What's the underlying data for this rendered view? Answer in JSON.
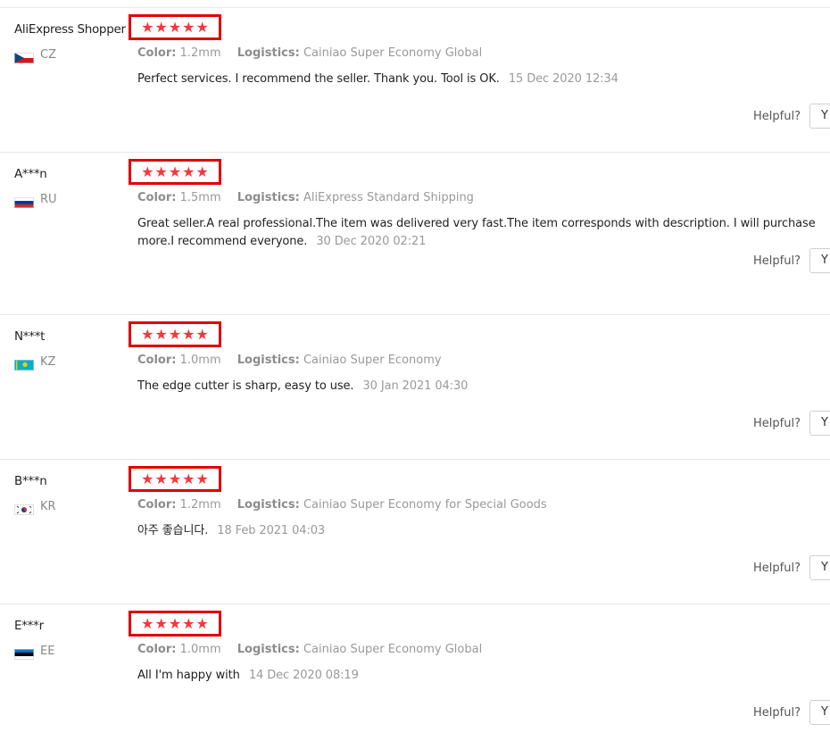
{
  "reviews": [
    {
      "user": "AliExpress Shopper",
      "country": "CZ",
      "flag": "cz",
      "stars": [
        "★",
        "★",
        "★",
        "★",
        "★"
      ],
      "rating": 5,
      "color_label": "Color:",
      "color_value": "1.2mm",
      "logistics_label": "Logistics:",
      "logistics_value": "Cainiao Super Economy Global",
      "text": "Perfect services. I recommend the seller. Thank you. Tool is OK.",
      "date": "15 Dec 2020 12:34",
      "helpful_label": "Helpful?",
      "helpful_button": "Y"
    },
    {
      "user": "A***n",
      "country": "RU",
      "flag": "ru",
      "stars": [
        "★",
        "★",
        "★",
        "★",
        "★"
      ],
      "rating": 5,
      "color_label": "Color:",
      "color_value": "1.5mm",
      "logistics_label": "Logistics:",
      "logistics_value": "AliExpress Standard Shipping",
      "text": "Great seller.A real professional.The item was delivered very fast.The item corresponds with description. I will purchase more.I recommend everyone.",
      "date": "30 Dec 2020 02:21",
      "helpful_label": "Helpful?",
      "helpful_button": "Y"
    },
    {
      "user": "N***t",
      "country": "KZ",
      "flag": "kz",
      "stars": [
        "★",
        "★",
        "★",
        "★",
        "★"
      ],
      "rating": 5,
      "color_label": "Color:",
      "color_value": "1.0mm",
      "logistics_label": "Logistics:",
      "logistics_value": "Cainiao Super Economy",
      "text": "The edge cutter is sharp, easy to use.",
      "date": "30 Jan 2021 04:30",
      "helpful_label": "Helpful?",
      "helpful_button": "Y"
    },
    {
      "user": "B***n",
      "country": "KR",
      "flag": "kr",
      "stars": [
        "★",
        "★",
        "★",
        "★",
        "★"
      ],
      "rating": 5,
      "color_label": "Color:",
      "color_value": "1.2mm",
      "logistics_label": "Logistics:",
      "logistics_value": "Cainiao Super Economy for Special Goods",
      "text": "아주 좋습니다.",
      "date": "18 Feb 2021 04:03",
      "helpful_label": "Helpful?",
      "helpful_button": "Y"
    },
    {
      "user": "E***r",
      "country": "EE",
      "flag": "ee",
      "stars": [
        "★",
        "★",
        "★",
        "★",
        "★"
      ],
      "rating": 5,
      "color_label": "Color:",
      "color_value": "1.0mm",
      "logistics_label": "Logistics:",
      "logistics_value": "Cainiao Super Economy Global",
      "text": "All I'm happy with",
      "date": "14 Dec 2020 08:19",
      "helpful_label": "Helpful?",
      "helpful_button": "Y"
    }
  ],
  "colors": {
    "highlight_border": "#e00000",
    "star": "#f2383f"
  }
}
